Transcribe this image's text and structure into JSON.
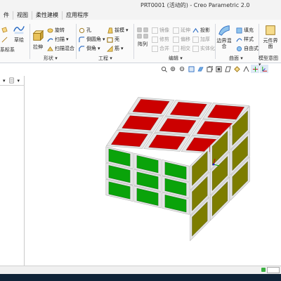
{
  "window": {
    "title": "PRT0001 (活动的) - Creo Parametric 2.0"
  },
  "tabs": [
    {
      "label": "件"
    },
    {
      "label": "视图"
    },
    {
      "label": "柔性建模"
    },
    {
      "label": "应用程序"
    }
  ],
  "ribbon": {
    "datum": {
      "coord_label": "系标系",
      "sketch_label": "草绘"
    },
    "shapes": {
      "extrude_label": "拉伸",
      "revolve_label": "旋转",
      "sweep_label": "扫描",
      "blend_label": "扫描混合",
      "group_label": "形状"
    },
    "engineering": {
      "hole_label": "孔",
      "round_label": "倒圆角",
      "chamfer_label": "倒角",
      "pattern_label": "拔模",
      "shell_label": "壳",
      "rib_label": "筋",
      "group_label": "工程"
    },
    "editing": {
      "array_label": "阵列",
      "mirror_label": "镜像",
      "extend_label": "延伸",
      "project_label": "投影",
      "trim_label": "修剪",
      "offset_label": "偏移",
      "thicken_label": "加厚",
      "merge_label": "合并",
      "intersect_label": "相交",
      "solidify_label": "实体化",
      "group_label": "编辑"
    },
    "surfaces": {
      "boundary_label": "边界混合",
      "fill_label": "填充",
      "style_label": "样式",
      "freeform_label": "自由式",
      "group_label": "曲面"
    },
    "model_intent": {
      "component_label": "元件界面",
      "group_label": "模型意图"
    }
  },
  "cube": {
    "top_color": "#cc0000",
    "left_color": "#0aa30a",
    "right_color": "#7d7d00",
    "gap_color": "#e6e6e6"
  }
}
